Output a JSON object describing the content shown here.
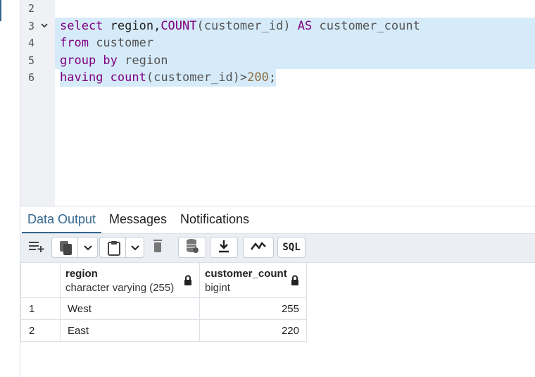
{
  "editor": {
    "lines": [
      {
        "num": "2"
      },
      {
        "num": "3"
      },
      {
        "num": "4"
      },
      {
        "num": "5"
      },
      {
        "num": "6"
      }
    ],
    "code": {
      "l3_kw": "select",
      "l3_a": " region,",
      "l3_fn": "COUNT",
      "l3_b": "(customer_id) ",
      "l3_as": "AS",
      "l3_c": " customer_count",
      "l4_kw": "from",
      "l4_a": " customer",
      "l5_kw": "group by",
      "l5_a": " region",
      "l6_kw": "having",
      "l6_fn": "count",
      "l6_a": "(customer_id)>",
      "l6_num": "200",
      "l6_end": ";"
    }
  },
  "tabs": {
    "data_output": "Data Output",
    "messages": "Messages",
    "notifications": "Notifications"
  },
  "toolbar": {
    "sql_label": "SQL"
  },
  "results": {
    "columns": [
      {
        "name": "region",
        "type": "character varying (255)"
      },
      {
        "name": "customer_count",
        "type": "bigint"
      }
    ],
    "rows": [
      {
        "num": "1",
        "region": "West",
        "count": "255"
      },
      {
        "num": "2",
        "region": "East",
        "count": "220"
      }
    ]
  },
  "colors": {
    "accent": "#326690",
    "selection": "#d6ebf9"
  }
}
